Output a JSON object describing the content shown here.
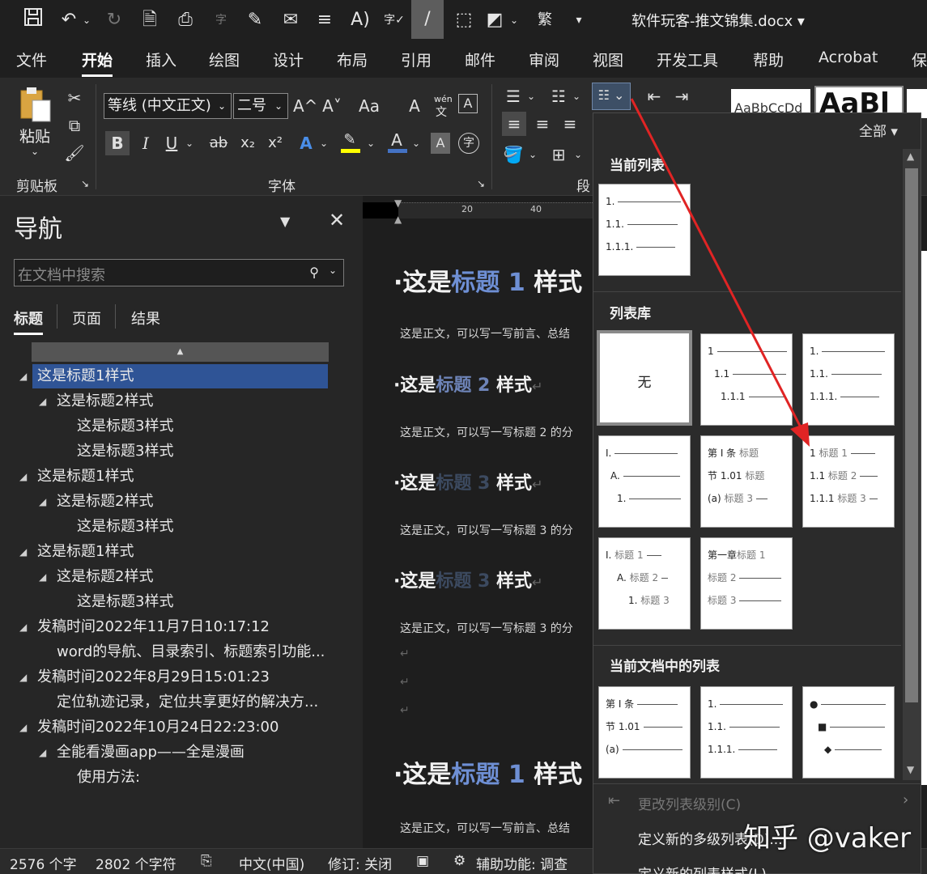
{
  "window": {
    "title": "软件玩客-推文锦集.docx ▾"
  },
  "ribbon_tabs": [
    "文件",
    "开始",
    "插入",
    "绘图",
    "设计",
    "布局",
    "引用",
    "邮件",
    "审阅",
    "视图",
    "开发工具",
    "帮助",
    "Acrobat",
    "保"
  ],
  "ribbon": {
    "paste_label": "粘贴",
    "clipboard_label": "剪贴板",
    "font_group_label": "字体",
    "paragraph_label": "段",
    "font_name": "等线 (中文正文)",
    "font_size": "二号",
    "style_preview": "AaBbCcDd",
    "style_preview_big": "AaBl",
    "wen_label": "wén",
    "wen_char": "文",
    "grow_font": "A^",
    "shrink_font": "A˅",
    "change_case": "Aa",
    "clear_fmt": "A",
    "bold": "B",
    "italic": "I",
    "underline": "U",
    "strike": "ab",
    "subscript": "x₂",
    "superscript": "x²",
    "text_effect": "A",
    "font_color": "A",
    "char_shade": "A",
    "enclose": "字"
  },
  "nav": {
    "title": "导航",
    "search_placeholder": "在文档中搜索",
    "tabs": [
      "标题",
      "页面",
      "结果"
    ],
    "items": [
      {
        "text": "这是标题1样式"
      },
      {
        "text": "这是标题2样式"
      },
      {
        "text": "这是标题3样式"
      },
      {
        "text": "这是标题3样式"
      },
      {
        "text": "这是标题1样式"
      },
      {
        "text": "这是标题2样式"
      },
      {
        "text": "这是标题3样式"
      },
      {
        "text": "这是标题1样式"
      },
      {
        "text": "这是标题2样式"
      },
      {
        "text": "这是标题3样式"
      },
      {
        "text": "发稿时间2022年11月7日10:17:12"
      },
      {
        "text": "word的导航、目录索引、标题索引功能..."
      },
      {
        "text": "发稿时间2022年8月29日15:01:23"
      },
      {
        "text": "定位轨迹记录，定位共享更好的解决方..."
      },
      {
        "text": "发稿时间2022年10月24日22:23:00"
      },
      {
        "text": "全能看漫画app——全是漫画"
      },
      {
        "text": "使用方法:"
      }
    ]
  },
  "ruler": {
    "mark1": "20",
    "mark2": "40"
  },
  "document": {
    "h1_a_pre": "这是",
    "h1_a_num": "标题 1",
    "h1_a_post": " 样式",
    "p1": "这是正文，可以写一写前言、总结",
    "h2_pre": "这是",
    "h2_num": "标题 2",
    "h2_post": " 样式",
    "p2": "这是正文，可以写一写标题 2 的分",
    "h3a_pre": "这是",
    "h3a_num": "标题 3",
    "h3a_post": " 样式",
    "p3": "这是正文，可以写一写标题 3 的分",
    "h3b_pre": "这是",
    "h3b_num": "标题 3",
    "h3b_post": " 样式",
    "p4": "这是正文，可以写一写标题 3 的分",
    "h1_b_pre": "这是",
    "h1_b_num": "标题 1",
    "h1_b_post": " 样式",
    "p5": "这是正文，可以写一写前言、总结",
    "para_mark": "↵"
  },
  "dropdown": {
    "filter": "全部 ▾",
    "sec_current": "当前列表",
    "sec_library": "列表库",
    "sec_doc": "当前文档中的列表",
    "none_label": "无",
    "menu_change_level": "更改列表级别(C)",
    "menu_define_new": "定义新的多级列表(D)...",
    "menu_define_style": "定义新的列表样式(L)..."
  },
  "status": {
    "words": "2576 个字",
    "chars": "2802 个字符",
    "lang": "中文(中国)",
    "track": "修订: 关闭",
    "access": "辅助功能: 调查"
  },
  "watermark": "知乎 @vaker",
  "colors": {
    "accent": "#2f5496",
    "arrow": "#e02424",
    "heading_blue": "#6e8fd4"
  }
}
